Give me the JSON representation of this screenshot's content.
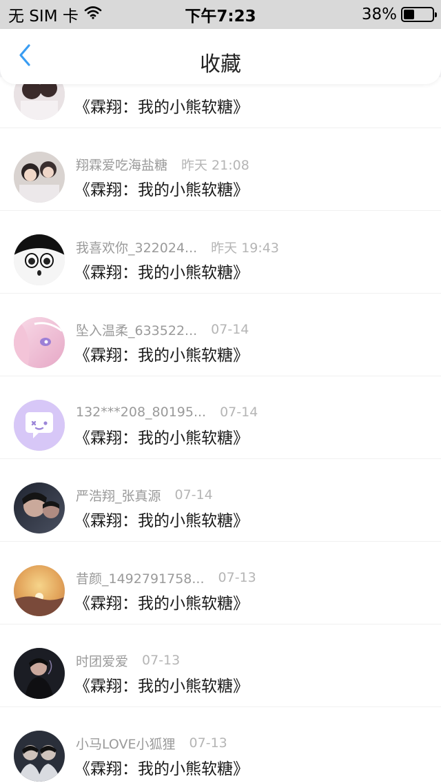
{
  "status_bar": {
    "carrier": "无 SIM 卡",
    "time": "下午7:23",
    "battery_percent": "38%",
    "battery_level": 0.38
  },
  "nav": {
    "title": "收藏"
  },
  "list": {
    "items": [
      {
        "user": "",
        "time": "",
        "title": "《霖翔：我的小熊软糖》"
      },
      {
        "user": "翔霖爱吃海盐糖",
        "time": "昨天 21:08",
        "title": "《霖翔：我的小熊软糖》"
      },
      {
        "user": "我喜欢你_322024...",
        "time": "昨天 19:43",
        "title": "《霖翔：我的小熊软糖》"
      },
      {
        "user": "坠入温柔_633522...",
        "time": "07-14",
        "title": "《霖翔：我的小熊软糖》"
      },
      {
        "user": "132***208_80195...",
        "time": "07-14",
        "title": "《霖翔：我的小熊软糖》"
      },
      {
        "user": "严浩翔_张真源",
        "time": "07-14",
        "title": "《霖翔：我的小熊软糖》"
      },
      {
        "user": "昔颜_1492791758...",
        "time": "07-13",
        "title": "《霖翔：我的小熊软糖》"
      },
      {
        "user": "时团爱爱",
        "time": "07-13",
        "title": "《霖翔：我的小熊软糖》"
      },
      {
        "user": "小马LOVE小狐狸",
        "time": "07-13",
        "title": "《霖翔：我的小熊软糖》"
      }
    ]
  },
  "colors": {
    "accent": "#3a9df2",
    "status_bar_bg": "#d9d9d9"
  }
}
